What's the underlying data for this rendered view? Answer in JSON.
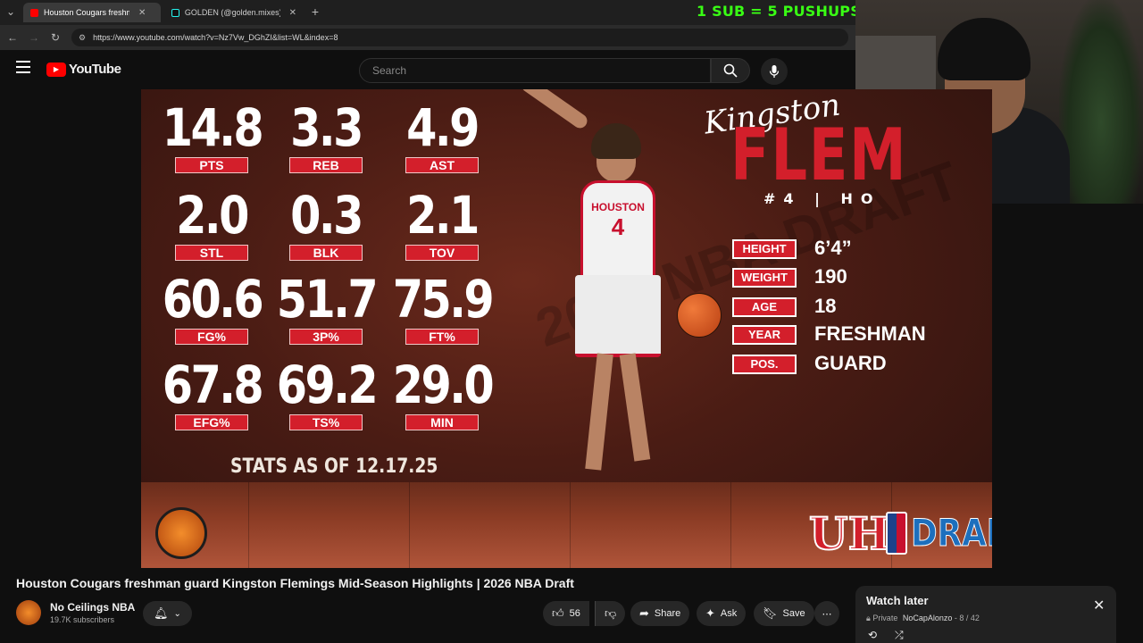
{
  "overlay": {
    "pushups_text": "1 SUB = 5 PUSHUPS"
  },
  "browser": {
    "tabs": [
      {
        "label": "Houston Cougars freshma",
        "active": true,
        "icon": "youtube-icon"
      },
      {
        "label": "GOLDEN (@golden.mixes) | Ti",
        "active": false,
        "icon": "tiktok-icon"
      }
    ],
    "new_tab": "+",
    "url": "https://www.youtube.com/watch?v=Nz7Vw_DGhZI&list=WL&index=8"
  },
  "youtube": {
    "logo_text": "YouTube",
    "search_placeholder": "Search"
  },
  "graphic": {
    "stats": [
      {
        "value": "14.8",
        "label": "PTS"
      },
      {
        "value": "3.3",
        "label": "REB"
      },
      {
        "value": "4.9",
        "label": "AST"
      },
      {
        "value": "2.0",
        "label": "STL"
      },
      {
        "value": "0.3",
        "label": "BLK"
      },
      {
        "value": "2.1",
        "label": "TOV"
      },
      {
        "value": "60.6",
        "label": "FG%"
      },
      {
        "value": "51.7",
        "label": "3P%"
      },
      {
        "value": "75.9",
        "label": "FT%"
      },
      {
        "value": "67.8",
        "label": "EFG%"
      },
      {
        "value": "69.2",
        "label": "TS%"
      },
      {
        "value": "29.0",
        "label": "MIN"
      }
    ],
    "stats_as_of": "STATS AS OF 12.17.25",
    "first_name": "Kingston",
    "last_name": "FLEM",
    "jersey_line": "#4 | HO",
    "bio": [
      {
        "label": "HEIGHT",
        "value": "6’4”"
      },
      {
        "label": "WEIGHT",
        "value": "190"
      },
      {
        "label": "AGE",
        "value": "18"
      },
      {
        "label": "YEAR",
        "value": "FRESHMAN"
      },
      {
        "label": "POS.",
        "value": "GUARD"
      }
    ],
    "player_jersey_text": "HOUSTON",
    "player_number": "4",
    "draft_logo_text": "DRAFT",
    "uh_logo_text": "UH",
    "background_watermark": "2026 NBA DRAFT"
  },
  "video": {
    "title": "Houston Cougars freshman guard Kingston Flemings Mid-Season Highlights | 2026 NBA Draft",
    "channel": "No Ceilings NBA",
    "subscribers": "19.7K subscribers",
    "likes": "56",
    "share_label": "Share",
    "ask_label": "Ask",
    "save_label": "Save"
  },
  "watch_later": {
    "title": "Watch later",
    "privacy": "Private",
    "owner": "NoCapAlonzo",
    "position": "8 / 42"
  },
  "colors": {
    "accent_red": "#d31f2b",
    "pushups_green": "#39ff14",
    "yt_red": "#ff0000"
  }
}
